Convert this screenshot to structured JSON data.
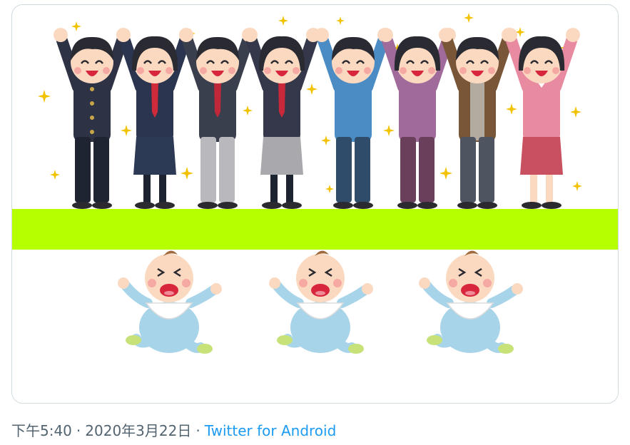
{
  "tweet": {
    "time": "下午5:40",
    "separator": "·",
    "date": "2020年3月22日",
    "source": "Twitter for Android"
  },
  "media": {
    "people_count": 8,
    "baby_count": 3,
    "colors": {
      "band": "#b5ff00",
      "border": "#cfd9de",
      "sparkle": "#f2c200",
      "skin": "#fbd9c0",
      "cheek": "#f6a8a2",
      "hair": "#2a2a33",
      "mouth": "#d8263c",
      "baby_suit": "#a8d4ea",
      "baby_shoe": "#c8e27a",
      "link": "#1d9bf0",
      "meta_text": "#536471"
    },
    "people": [
      {
        "role": "schoolboy",
        "top": "#2d3345",
        "bottom": "#1f2433",
        "accent": "#caa64a"
      },
      {
        "role": "schoolgirl",
        "top": "#2b3550",
        "bottom": "#2d3a55",
        "accent": "#d02b3a"
      },
      {
        "role": "office-man",
        "top": "#3a3f4e",
        "bottom": "#b9b9bd",
        "accent": "#c0283a"
      },
      {
        "role": "schoolgirl-ribbon",
        "top": "#34384a",
        "bottom": "#a9a9ad",
        "accent": "#c8283a"
      },
      {
        "role": "man-blue",
        "top": "#4b8cc4",
        "bottom": "#2f4d6b",
        "accent": "#4b8cc4"
      },
      {
        "role": "woman-purple",
        "top": "#a06a9a",
        "bottom": "#6a3f5c",
        "accent": "#a06a9a"
      },
      {
        "role": "man-brown",
        "top": "#7a5638",
        "bottom": "#4f5461",
        "accent": "#b3aaa0"
      },
      {
        "role": "woman-pink",
        "top": "#e88aa0",
        "bottom": "#c85060",
        "accent": "#ffffff"
      }
    ]
  }
}
